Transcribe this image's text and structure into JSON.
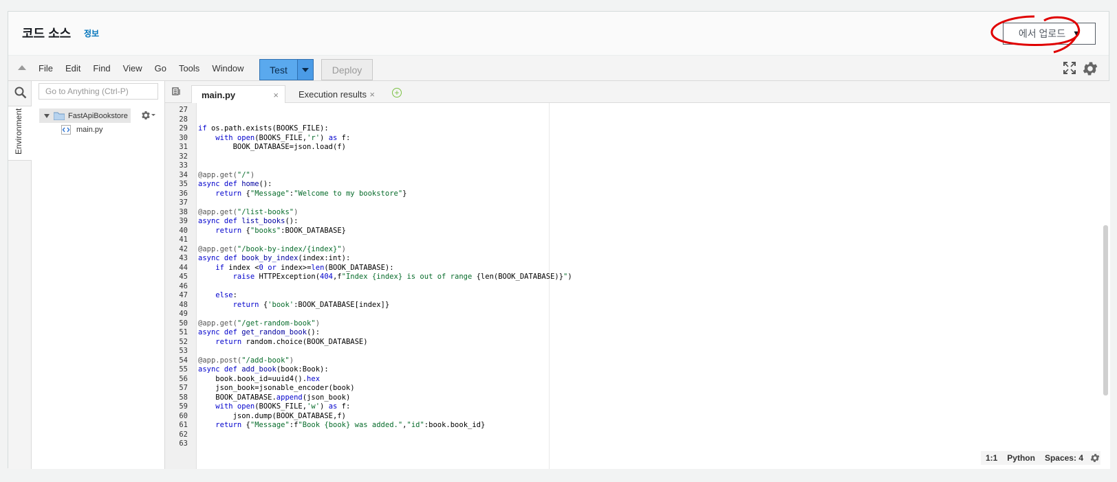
{
  "header": {
    "title": "코드 소스",
    "info_link": "정보",
    "upload_button": "에서 업로드"
  },
  "menubar": {
    "items": [
      "File",
      "Edit",
      "Find",
      "View",
      "Go",
      "Tools",
      "Window"
    ],
    "test_label": "Test",
    "deploy_label": "Deploy"
  },
  "sidebar": {
    "environment_tab": "Environment",
    "goto_placeholder": "Go to Anything (Ctrl-P)",
    "root_folder": "FastApiBookstore",
    "file": "main.py"
  },
  "tabs": {
    "active": "main.py",
    "inactive": "Execution results"
  },
  "editor": {
    "lines": [
      {
        "n": "27",
        "segs": [
          [
            "",
            ""
          ]
        ]
      },
      {
        "n": "28",
        "segs": [
          [
            "",
            ""
          ]
        ]
      },
      {
        "n": "29",
        "segs": [
          [
            "kw",
            "if"
          ],
          [
            "",
            " os.path.exists(BOOKS_FILE):"
          ]
        ]
      },
      {
        "n": "30",
        "segs": [
          [
            "",
            "    "
          ],
          [
            "kw",
            "with"
          ],
          [
            "",
            " "
          ],
          [
            "kw",
            "open"
          ],
          [
            "",
            "(BOOKS_FILE,"
          ],
          [
            "st",
            "'r'"
          ],
          [
            "",
            ") "
          ],
          [
            "kw",
            "as"
          ],
          [
            "",
            " f:"
          ]
        ]
      },
      {
        "n": "31",
        "segs": [
          [
            "",
            "        BOOK_DATABASE=json.load(f)"
          ]
        ]
      },
      {
        "n": "32",
        "segs": [
          [
            "",
            ""
          ]
        ]
      },
      {
        "n": "33",
        "segs": [
          [
            "",
            ""
          ]
        ]
      },
      {
        "n": "34",
        "segs": [
          [
            "dc",
            "@app.get("
          ],
          [
            "st",
            "\"/\""
          ],
          [
            "dc",
            ")"
          ]
        ]
      },
      {
        "n": "35",
        "segs": [
          [
            "kw",
            "async def"
          ],
          [
            "",
            " "
          ],
          [
            "fn",
            "home"
          ],
          [
            "",
            "():"
          ]
        ]
      },
      {
        "n": "36",
        "segs": [
          [
            "",
            "    "
          ],
          [
            "kw",
            "return"
          ],
          [
            "",
            " {"
          ],
          [
            "st",
            "\"Message\""
          ],
          [
            "",
            ":"
          ],
          [
            "st",
            "\"Welcome to my bookstore\""
          ],
          [
            "",
            "}"
          ]
        ]
      },
      {
        "n": "37",
        "segs": [
          [
            "",
            ""
          ]
        ]
      },
      {
        "n": "38",
        "segs": [
          [
            "dc",
            "@app.get("
          ],
          [
            "st",
            "\"/list-books\""
          ],
          [
            "dc",
            ")"
          ]
        ]
      },
      {
        "n": "39",
        "segs": [
          [
            "kw",
            "async def"
          ],
          [
            "",
            " "
          ],
          [
            "fn",
            "list_books"
          ],
          [
            "",
            "():"
          ]
        ]
      },
      {
        "n": "40",
        "segs": [
          [
            "",
            "    "
          ],
          [
            "kw",
            "return"
          ],
          [
            "",
            " {"
          ],
          [
            "st",
            "\"books\""
          ],
          [
            "",
            ":BOOK_DATABASE}"
          ]
        ]
      },
      {
        "n": "41",
        "segs": [
          [
            "",
            ""
          ]
        ]
      },
      {
        "n": "42",
        "segs": [
          [
            "dc",
            "@app.get("
          ],
          [
            "st",
            "\"/book-by-index/{index}\""
          ],
          [
            "dc",
            ")"
          ]
        ]
      },
      {
        "n": "43",
        "segs": [
          [
            "kw",
            "async def"
          ],
          [
            "",
            " "
          ],
          [
            "fn",
            "book_by_index"
          ],
          [
            "",
            "(index:int):"
          ]
        ]
      },
      {
        "n": "44",
        "segs": [
          [
            "",
            "    "
          ],
          [
            "kw",
            "if"
          ],
          [
            "",
            " index <"
          ],
          [
            "nm",
            "0"
          ],
          [
            "",
            " "
          ],
          [
            "kw",
            "or"
          ],
          [
            "",
            " index>="
          ],
          [
            "kw",
            "len"
          ],
          [
            "",
            "(BOOK_DATABASE):"
          ]
        ]
      },
      {
        "n": "45",
        "segs": [
          [
            "",
            "        "
          ],
          [
            "kw",
            "raise"
          ],
          [
            "",
            " HTTPException("
          ],
          [
            "nm",
            "404"
          ],
          [
            "",
            ",f"
          ],
          [
            "st",
            "\"Index {index} is out of range "
          ],
          [
            "",
            "{len(BOOK_DATABASE)}"
          ],
          [
            "st",
            "\""
          ],
          [
            "",
            ")"
          ]
        ]
      },
      {
        "n": "46",
        "segs": [
          [
            "",
            ""
          ]
        ]
      },
      {
        "n": "47",
        "segs": [
          [
            "",
            "    "
          ],
          [
            "kw",
            "else"
          ],
          [
            "",
            ":"
          ]
        ]
      },
      {
        "n": "48",
        "segs": [
          [
            "",
            "        "
          ],
          [
            "kw",
            "return"
          ],
          [
            "",
            " {"
          ],
          [
            "st",
            "'book'"
          ],
          [
            "",
            ":BOOK_DATABASE[index]}"
          ]
        ]
      },
      {
        "n": "49",
        "segs": [
          [
            "",
            ""
          ]
        ]
      },
      {
        "n": "50",
        "segs": [
          [
            "dc",
            "@app.get("
          ],
          [
            "st",
            "\"/get-random-book\""
          ],
          [
            "dc",
            ")"
          ]
        ]
      },
      {
        "n": "51",
        "segs": [
          [
            "kw",
            "async def"
          ],
          [
            "",
            " "
          ],
          [
            "fn",
            "get_random_book"
          ],
          [
            "",
            "():"
          ]
        ]
      },
      {
        "n": "52",
        "segs": [
          [
            "",
            "    "
          ],
          [
            "kw",
            "return"
          ],
          [
            "",
            " random.choice(BOOK_DATABASE)"
          ]
        ]
      },
      {
        "n": "53",
        "segs": [
          [
            "",
            ""
          ]
        ]
      },
      {
        "n": "54",
        "segs": [
          [
            "dc",
            "@app.post("
          ],
          [
            "st",
            "\"/add-book\""
          ],
          [
            "dc",
            ")"
          ]
        ]
      },
      {
        "n": "55",
        "segs": [
          [
            "kw",
            "async def"
          ],
          [
            "",
            " "
          ],
          [
            "fn",
            "add_book"
          ],
          [
            "",
            "(book:Book):"
          ]
        ]
      },
      {
        "n": "56",
        "segs": [
          [
            "",
            "    book.book_id=uuid4()."
          ],
          [
            "kw",
            "hex"
          ]
        ]
      },
      {
        "n": "57",
        "segs": [
          [
            "",
            "    json_book=jsonable_encoder(book)"
          ]
        ]
      },
      {
        "n": "58",
        "segs": [
          [
            "",
            "    BOOK_DATABASE."
          ],
          [
            "kw",
            "append"
          ],
          [
            "",
            "(json_book)"
          ]
        ]
      },
      {
        "n": "59",
        "segs": [
          [
            "",
            "    "
          ],
          [
            "kw",
            "with"
          ],
          [
            "",
            " "
          ],
          [
            "kw",
            "open"
          ],
          [
            "",
            "(BOOKS_FILE,"
          ],
          [
            "st",
            "'w'"
          ],
          [
            "",
            ") "
          ],
          [
            "kw",
            "as"
          ],
          [
            "",
            " f:"
          ]
        ]
      },
      {
        "n": "60",
        "segs": [
          [
            "",
            "        json.dump(BOOK_DATABASE,f)"
          ]
        ]
      },
      {
        "n": "61",
        "segs": [
          [
            "",
            "    "
          ],
          [
            "kw",
            "return"
          ],
          [
            "",
            " {"
          ],
          [
            "st",
            "\"Message\""
          ],
          [
            "",
            ":f"
          ],
          [
            "st",
            "\"Book {book} was added.\""
          ],
          [
            "",
            ","
          ],
          [
            "st",
            "\"id\""
          ],
          [
            "",
            ":book.book_id}"
          ]
        ]
      },
      {
        "n": "62",
        "segs": [
          [
            "",
            ""
          ]
        ]
      },
      {
        "n": "63",
        "segs": [
          [
            "",
            ""
          ]
        ]
      }
    ]
  },
  "status": {
    "cursor": "1:1",
    "language": "Python",
    "spaces": "Spaces: 4"
  }
}
